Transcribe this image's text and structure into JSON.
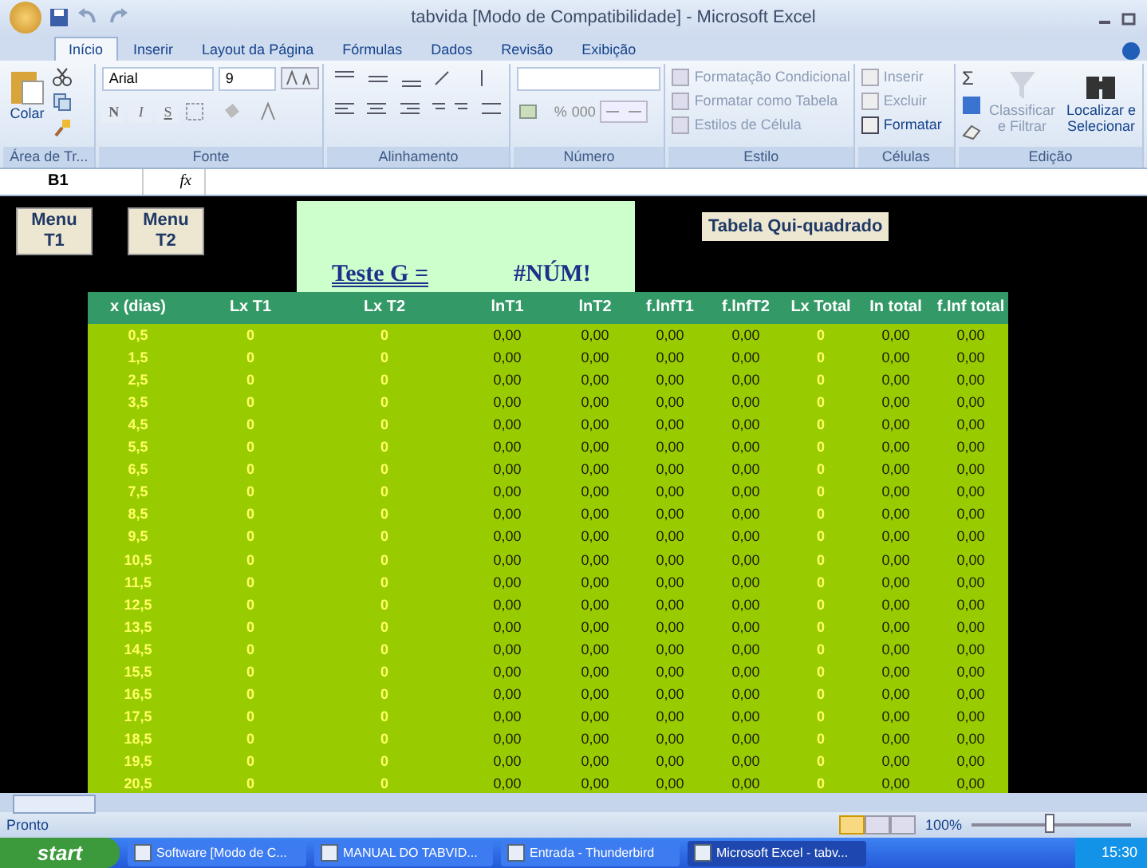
{
  "window": {
    "title": "tabvida  [Modo de Compatibilidade] - Microsoft Excel"
  },
  "tabs": [
    {
      "label": "Início",
      "selected": true
    },
    {
      "label": "Inserir",
      "selected": false
    },
    {
      "label": "Layout da Página",
      "selected": false
    },
    {
      "label": "Fórmulas",
      "selected": false
    },
    {
      "label": "Dados",
      "selected": false
    },
    {
      "label": "Revisão",
      "selected": false
    },
    {
      "label": "Exibição",
      "selected": false
    }
  ],
  "clipboard": {
    "paste": "Colar",
    "label": "Área de Tr..."
  },
  "font": {
    "name": "Arial",
    "size": "9",
    "label": "Fonte",
    "bold": "N",
    "italic": "I",
    "underline": "S"
  },
  "alignment": {
    "label": "Alinhamento"
  },
  "number": {
    "percent": "%",
    "thousands": "000",
    "label": "Número"
  },
  "styles": {
    "items": [
      {
        "label": "Formatação Condicional",
        "disabled": true
      },
      {
        "label": "Formatar como Tabela",
        "disabled": true
      },
      {
        "label": "Estilos de Célula",
        "disabled": true
      }
    ],
    "label": "Estilo"
  },
  "cells": {
    "items": [
      {
        "label": "Inserir",
        "disabled": true
      },
      {
        "label": "Excluir",
        "disabled": true
      },
      {
        "label": "Formatar",
        "disabled": false
      }
    ],
    "label": "Células"
  },
  "editing": {
    "sort": {
      "lines": [
        "Classificar",
        "e Filtrar"
      ],
      "disabled": true
    },
    "find": {
      "lines": [
        "Localizar e",
        "Selecionar"
      ],
      "disabled": false
    },
    "sum": "Σ",
    "label": "Edição"
  },
  "formula_bar": {
    "name_box": "B1",
    "fx": "fx"
  },
  "sheet": {
    "menu_buttons": [
      "Menu T1",
      "Menu T2"
    ],
    "test_label": "Teste G =",
    "test_value": "#NÚM!",
    "table_button": "Tabela Qui-quadrado",
    "columns": [
      "x (dias)",
      "Lx T1",
      "Lx T2",
      "lnT1",
      "lnT2",
      "f.lnfT1",
      "f.lnfT2",
      "Lx Total",
      "In total",
      "f.Inf total"
    ],
    "rows": [
      [
        "0,5",
        "0",
        "0",
        "0,00",
        "0,00",
        "0,00",
        "0,00",
        "0",
        "0,00",
        "0,00"
      ],
      [
        "1,5",
        "0",
        "0",
        "0,00",
        "0,00",
        "0,00",
        "0,00",
        "0",
        "0,00",
        "0,00"
      ],
      [
        "2,5",
        "0",
        "0",
        "0,00",
        "0,00",
        "0,00",
        "0,00",
        "0",
        "0,00",
        "0,00"
      ],
      [
        "3,5",
        "0",
        "0",
        "0,00",
        "0,00",
        "0,00",
        "0,00",
        "0",
        "0,00",
        "0,00"
      ],
      [
        "4,5",
        "0",
        "0",
        "0,00",
        "0,00",
        "0,00",
        "0,00",
        "0",
        "0,00",
        "0,00"
      ],
      [
        "5,5",
        "0",
        "0",
        "0,00",
        "0,00",
        "0,00",
        "0,00",
        "0",
        "0,00",
        "0,00"
      ],
      [
        "6,5",
        "0",
        "0",
        "0,00",
        "0,00",
        "0,00",
        "0,00",
        "0",
        "0,00",
        "0,00"
      ],
      [
        "7,5",
        "0",
        "0",
        "0,00",
        "0,00",
        "0,00",
        "0,00",
        "0",
        "0,00",
        "0,00"
      ],
      [
        "8,5",
        "0",
        "0",
        "0,00",
        "0,00",
        "0,00",
        "0,00",
        "0",
        "0,00",
        "0,00"
      ],
      [
        "9,5",
        "0",
        "0",
        "0,00",
        "0,00",
        "0,00",
        "0,00",
        "0",
        "0,00",
        "0,00"
      ],
      [
        "10,5",
        "0",
        "0",
        "0,00",
        "0,00",
        "0,00",
        "0,00",
        "0",
        "0,00",
        "0,00"
      ],
      [
        "11,5",
        "0",
        "0",
        "0,00",
        "0,00",
        "0,00",
        "0,00",
        "0",
        "0,00",
        "0,00"
      ],
      [
        "12,5",
        "0",
        "0",
        "0,00",
        "0,00",
        "0,00",
        "0,00",
        "0",
        "0,00",
        "0,00"
      ],
      [
        "13,5",
        "0",
        "0",
        "0,00",
        "0,00",
        "0,00",
        "0,00",
        "0",
        "0,00",
        "0,00"
      ],
      [
        "14,5",
        "0",
        "0",
        "0,00",
        "0,00",
        "0,00",
        "0,00",
        "0",
        "0,00",
        "0,00"
      ],
      [
        "15,5",
        "0",
        "0",
        "0,00",
        "0,00",
        "0,00",
        "0,00",
        "0",
        "0,00",
        "0,00"
      ],
      [
        "16,5",
        "0",
        "0",
        "0,00",
        "0,00",
        "0,00",
        "0,00",
        "0",
        "0,00",
        "0,00"
      ],
      [
        "17,5",
        "0",
        "0",
        "0,00",
        "0,00",
        "0,00",
        "0,00",
        "0",
        "0,00",
        "0,00"
      ],
      [
        "18,5",
        "0",
        "0",
        "0,00",
        "0,00",
        "0,00",
        "0,00",
        "0",
        "0,00",
        "0,00"
      ],
      [
        "19,5",
        "0",
        "0",
        "0,00",
        "0,00",
        "0,00",
        "0,00",
        "0",
        "0,00",
        "0,00"
      ],
      [
        "20,5",
        "0",
        "0",
        "0,00",
        "0,00",
        "0,00",
        "0,00",
        "0",
        "0,00",
        "0,00"
      ]
    ]
  },
  "status_bar": {
    "text": "Pronto",
    "zoom": "100%",
    "level": 0.5
  },
  "taskbar": {
    "start": "start",
    "items": [
      {
        "label": "Software [Modo de C...",
        "selected": false
      },
      {
        "label": "MANUAL DO TABVID...",
        "selected": false
      },
      {
        "label": "Entrada - Thunderbird",
        "selected": false
      },
      {
        "label": "Microsoft Excel - tabv...",
        "selected": true
      }
    ],
    "clock": "15:30"
  }
}
